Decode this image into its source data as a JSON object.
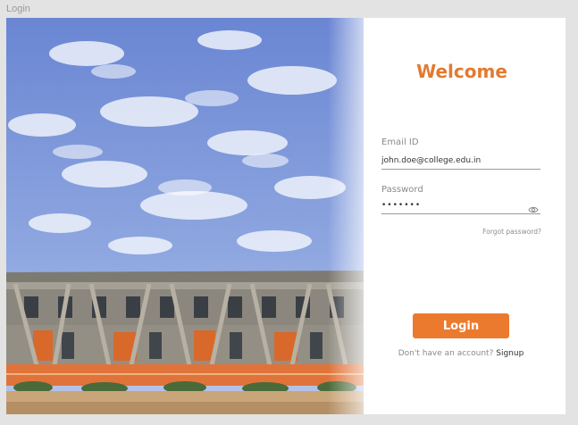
{
  "window": {
    "title": "Login"
  },
  "hero": {
    "alt": "College campus building under a blue sky"
  },
  "form": {
    "heading": "Welcome",
    "email": {
      "label": "Email ID",
      "value": "john.doe@college.edu.in"
    },
    "password": {
      "label": "Password",
      "value": "•••••••"
    },
    "forgot_label": "Forgot password?",
    "login_label": "Login",
    "signup_prompt": "Don't have an account?",
    "signup_label": "Signup"
  },
  "colors": {
    "accent": "#ec7a2e",
    "heading": "#e47a2e",
    "background": "#e3e3e3",
    "card": "#ffffff"
  },
  "icons": {
    "password_toggle": "eye-icon"
  }
}
